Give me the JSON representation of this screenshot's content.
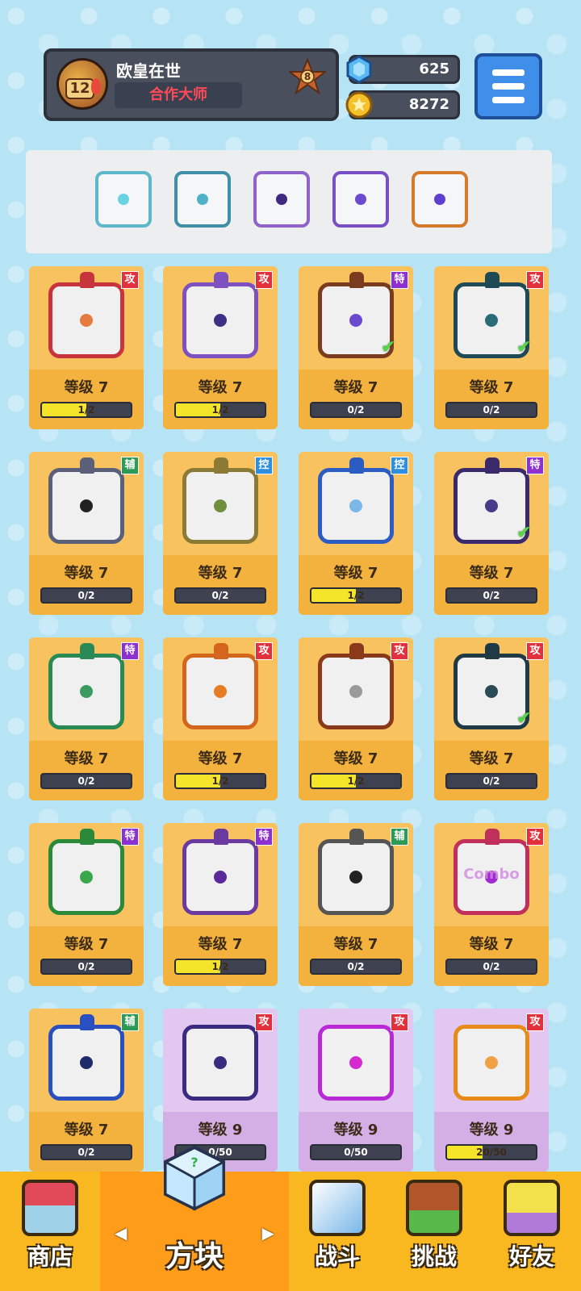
{
  "player": {
    "level": "12",
    "name": "欧皇在世",
    "title": "合作大师",
    "rank": "8"
  },
  "currency": {
    "gems": "625",
    "gold": "8272"
  },
  "menu_icon": "hamburger-menu-icon",
  "deck": [
    {
      "color": "#5fb8c9",
      "core": "#6bd2e2"
    },
    {
      "color": "#3f8fa6",
      "core": "#4fb0c8"
    },
    {
      "color": "#8f63c8",
      "core": "#3f2a80"
    },
    {
      "color": "#7a4fc6",
      "core": "#6b4ad0"
    },
    {
      "color": "#d47a2a",
      "core": "#5f3fd0"
    }
  ],
  "cards": [
    {
      "tag": "攻",
      "tag_type": "atk",
      "level": "等级 7",
      "progress": "1/2",
      "fill": 0.5,
      "border": "#c8343c",
      "core": "#e37c3e",
      "checked": false,
      "purple": false
    },
    {
      "tag": "攻",
      "tag_type": "atk",
      "level": "等级 7",
      "progress": "1/2",
      "fill": 0.5,
      "border": "#7d52c0",
      "core": "#3f2e86",
      "checked": false,
      "purple": false
    },
    {
      "tag": "特",
      "tag_type": "spc",
      "level": "等级 7",
      "progress": "0/2",
      "fill": 0,
      "border": "#7a3c1f",
      "core": "#6b4ad0",
      "checked": true,
      "purple": false
    },
    {
      "tag": "攻",
      "tag_type": "atk",
      "level": "等级 7",
      "progress": "0/2",
      "fill": 0,
      "border": "#1f4a55",
      "core": "#2b6b78",
      "checked": true,
      "purple": false
    },
    {
      "tag": "辅",
      "tag_type": "sup",
      "level": "等级 7",
      "progress": "0/2",
      "fill": 0,
      "border": "#5b5f7a",
      "core": "#222222",
      "checked": false,
      "purple": false
    },
    {
      "tag": "控",
      "tag_type": "ctl",
      "level": "等级 7",
      "progress": "0/2",
      "fill": 0,
      "border": "#8a7a36",
      "core": "#6f8f3f",
      "checked": false,
      "purple": false
    },
    {
      "tag": "控",
      "tag_type": "ctl",
      "level": "等级 7",
      "progress": "1/2",
      "fill": 0.5,
      "border": "#2a5cc4",
      "core": "#7bb8e8",
      "checked": false,
      "purple": false
    },
    {
      "tag": "特",
      "tag_type": "spc",
      "level": "等级 7",
      "progress": "0/2",
      "fill": 0,
      "border": "#3b2a6b",
      "core": "#4a3a8a",
      "checked": true,
      "purple": false
    },
    {
      "tag": "特",
      "tag_type": "spc",
      "level": "等级 7",
      "progress": "0/2",
      "fill": 0,
      "border": "#2a8a55",
      "core": "#3a9a60",
      "checked": false,
      "purple": false
    },
    {
      "tag": "攻",
      "tag_type": "atk",
      "level": "等级 7",
      "progress": "1/2",
      "fill": 0.5,
      "border": "#d4651c",
      "core": "#e77c23",
      "checked": false,
      "purple": false
    },
    {
      "tag": "攻",
      "tag_type": "atk",
      "level": "等级 7",
      "progress": "1/2",
      "fill": 0.5,
      "border": "#8a3a1a",
      "core": "#9a9a9a",
      "checked": false,
      "purple": false
    },
    {
      "tag": "攻",
      "tag_type": "atk",
      "level": "等级 7",
      "progress": "0/2",
      "fill": 0,
      "border": "#1f3a45",
      "core": "#2a4a55",
      "checked": true,
      "purple": false
    },
    {
      "tag": "特",
      "tag_type": "spc",
      "level": "等级 7",
      "progress": "0/2",
      "fill": 0,
      "border": "#2a8a3a",
      "core": "#3aa84a",
      "checked": false,
      "purple": false
    },
    {
      "tag": "特",
      "tag_type": "spc",
      "level": "等级 7",
      "progress": "1/2",
      "fill": 0.5,
      "border": "#6a3aa0",
      "core": "#5b2a9a",
      "checked": false,
      "purple": false
    },
    {
      "tag": "辅",
      "tag_type": "sup",
      "level": "等级 7",
      "progress": "0/2",
      "fill": 0,
      "border": "#555555",
      "core": "#222222",
      "checked": false,
      "purple": false
    },
    {
      "tag": "攻",
      "tag_type": "atk",
      "level": "等级 7",
      "progress": "0/2",
      "fill": 0,
      "border": "#c0305a",
      "core": "#a02acf",
      "checked": false,
      "purple": false,
      "text_overlay": "Combo"
    },
    {
      "tag": "辅",
      "tag_type": "sup",
      "level": "等级 7",
      "progress": "0/2",
      "fill": 0,
      "border": "#2a4fc0",
      "core": "#1f2a6a",
      "checked": false,
      "purple": false
    },
    {
      "tag": "攻",
      "tag_type": "atk",
      "level": "等级 9",
      "progress": "0/50",
      "fill": 0.0,
      "border": "#3a2a80",
      "core": "#3a2a80",
      "checked": false,
      "purple": true
    },
    {
      "tag": "攻",
      "tag_type": "atk",
      "level": "等级 9",
      "progress": "0/50",
      "fill": 0,
      "border": "#b92ad6",
      "core": "#d52acf",
      "checked": false,
      "purple": true
    },
    {
      "tag": "攻",
      "tag_type": "atk",
      "level": "等级 9",
      "progress": "20/50",
      "fill": 0.4,
      "border": "#e88a1a",
      "core": "#f0a045",
      "checked": false,
      "purple": true
    }
  ],
  "nav": {
    "shop": "商店",
    "dice": "方块",
    "battle": "战斗",
    "challenge": "挑战",
    "friends": "好友",
    "left_arrow": "◀",
    "right_arrow": "▶"
  }
}
